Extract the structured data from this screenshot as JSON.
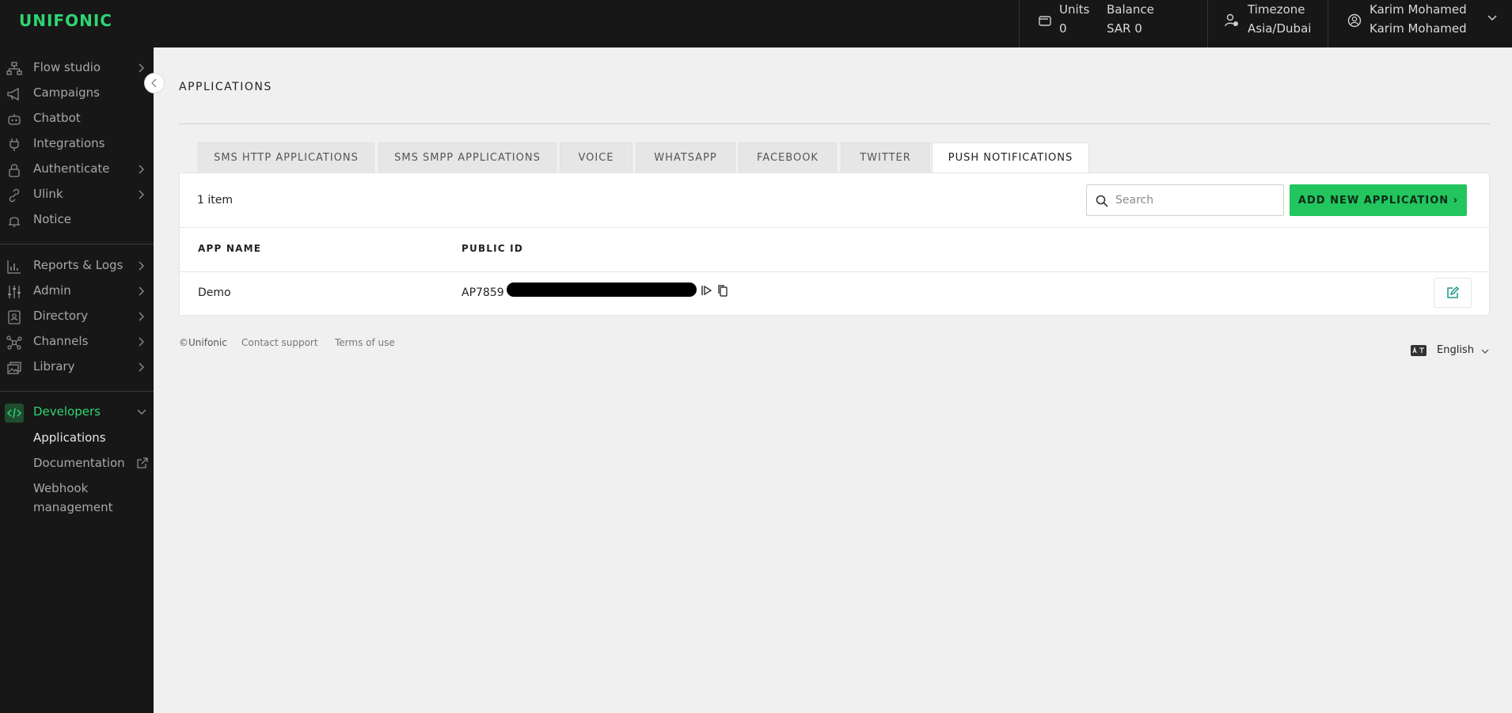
{
  "app": {
    "logo": "UNIFONIC"
  },
  "header": {
    "units_label": "Units",
    "units_value": "0",
    "balance_label": "Balance",
    "balance_value": "SAR 0",
    "timezone_label": "Timezone",
    "timezone_value": "Asia/Dubai",
    "user_name": "Karim Mohamed",
    "user_sub": "Karim Mohamed"
  },
  "sidebar": {
    "items": [
      {
        "label": "Flow studio",
        "icon": "flow-icon",
        "has_children": true
      },
      {
        "label": "Campaigns",
        "icon": "megaphone-icon",
        "has_children": false
      },
      {
        "label": "Chatbot",
        "icon": "robot-icon",
        "has_children": false
      },
      {
        "label": "Integrations",
        "icon": "plug-icon",
        "has_children": false
      },
      {
        "label": "Authenticate",
        "icon": "lock-icon",
        "has_children": true
      },
      {
        "label": "Ulink",
        "icon": "link-icon",
        "has_children": true
      },
      {
        "label": "Notice",
        "icon": "bell-icon",
        "has_children": false
      },
      {
        "label": "Reports & Logs",
        "icon": "chart-icon",
        "has_children": true
      },
      {
        "label": "Admin",
        "icon": "sliders-icon",
        "has_children": true
      },
      {
        "label": "Directory",
        "icon": "contact-book-icon",
        "has_children": true
      },
      {
        "label": "Channels",
        "icon": "network-icon",
        "has_children": true
      },
      {
        "label": "Library",
        "icon": "images-icon",
        "has_children": true
      }
    ],
    "developers": {
      "label": "Developers",
      "icon": "code-icon",
      "sub": [
        {
          "label": "Applications"
        },
        {
          "label": "Documentation"
        },
        {
          "label": "Webhook"
        },
        {
          "label": "management"
        }
      ]
    }
  },
  "main": {
    "title": "APPLICATIONS",
    "tabs": [
      {
        "label": "SMS HTTP APPLICATIONS"
      },
      {
        "label": "SMS SMPP APPLICATIONS"
      },
      {
        "label": "VOICE"
      },
      {
        "label": "WHATSAPP"
      },
      {
        "label": "FACEBOOK"
      },
      {
        "label": "TWITTER"
      },
      {
        "label": "PUSH NOTIFICATIONS"
      }
    ],
    "active_tab": "PUSH NOTIFICATIONS",
    "count": "1 item",
    "search_placeholder": "Search",
    "search_value": "",
    "add_button": "ADD NEW APPLICATION ›",
    "columns": [
      "APP NAME",
      "PUBLIC ID"
    ],
    "rows": [
      {
        "app_name": "Demo",
        "public_id": "AP7859"
      }
    ]
  },
  "footer": {
    "copyright": "©Unifonic",
    "contact": "Contact support",
    "terms": "Terms of use",
    "language": "English"
  },
  "colors": {
    "brand": "#2ed573",
    "sidebar_bg": "#171717",
    "accent_button": "#22c55e",
    "active_nav": "#2ed573"
  }
}
